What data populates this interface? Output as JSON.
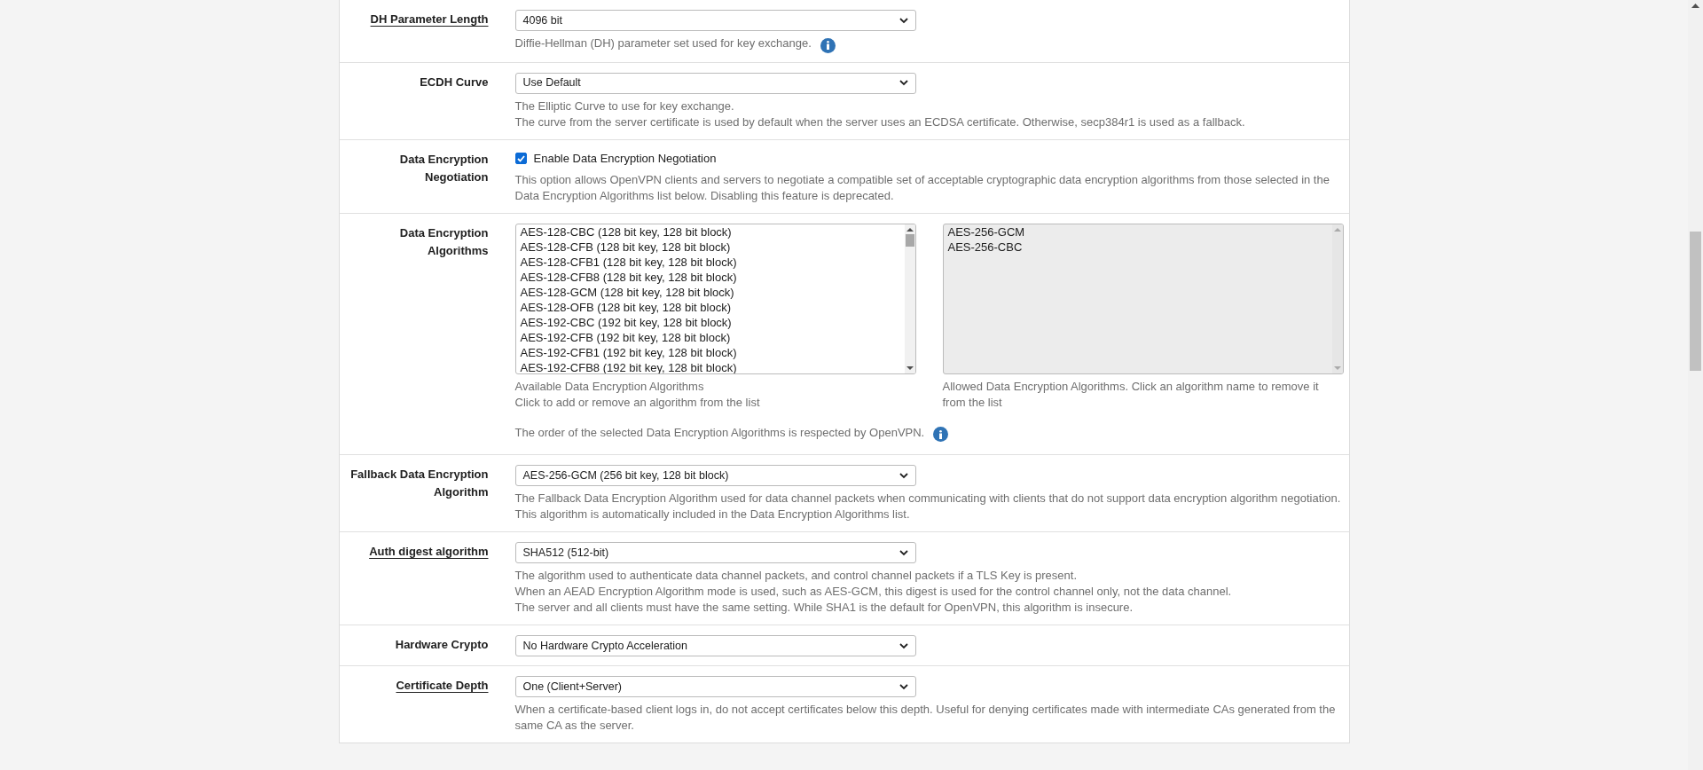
{
  "rows": [
    {
      "label": "DH Parameter Length",
      "label_link": true,
      "kind": "select",
      "value": "4096 bit",
      "help": [
        "Diffie-Hellman (DH) parameter set used for key exchange."
      ],
      "info": true
    },
    {
      "label": "ECDH Curve",
      "label_link": false,
      "kind": "select",
      "value": "Use Default",
      "help": [
        "The Elliptic Curve to use for key exchange.",
        "The curve from the server certificate is used by default when the server uses an ECDSA certificate. Otherwise, secp384r1 is used as a fallback."
      ],
      "info": false
    },
    {
      "label": "Data Encryption Negotiation",
      "label_link": false,
      "kind": "checkbox",
      "checked": true,
      "value": "Enable Data Encryption Negotiation",
      "help": [
        "This option allows OpenVPN clients and servers to negotiate a compatible set of acceptable cryptographic data encryption algorithms from those selected in the Data Encryption Algorithms list below. Disabling this feature is deprecated."
      ],
      "info": false
    },
    {
      "label": "Data Encryption Algorithms",
      "label_link": false,
      "kind": "dual-list",
      "available": [
        "AES-128-CBC (128 bit key, 128 bit block)",
        "AES-128-CFB (128 bit key, 128 bit block)",
        "AES-128-CFB1 (128 bit key, 128 bit block)",
        "AES-128-CFB8 (128 bit key, 128 bit block)",
        "AES-128-GCM (128 bit key, 128 bit block)",
        "AES-128-OFB (128 bit key, 128 bit block)",
        "AES-192-CBC (192 bit key, 128 bit block)",
        "AES-192-CFB (192 bit key, 128 bit block)",
        "AES-192-CFB1 (192 bit key, 128 bit block)",
        "AES-192-CFB8 (192 bit key, 128 bit block)"
      ],
      "available_help": [
        "Available Data Encryption Algorithms",
        "Click to add or remove an algorithm from the list"
      ],
      "allowed": [
        "AES-256-GCM",
        "AES-256-CBC"
      ],
      "allowed_help": [
        "Allowed Data Encryption Algorithms. Click an algorithm name to remove it from the list"
      ],
      "help": [
        "The order of the selected Data Encryption Algorithms is respected by OpenVPN."
      ],
      "info": true
    },
    {
      "label": "Fallback Data Encryption Algorithm",
      "label_link": false,
      "kind": "select",
      "value": "AES-256-GCM (256 bit key, 128 bit block)",
      "help": [
        "The Fallback Data Encryption Algorithm used for data channel packets when communicating with clients that do not support data encryption algorithm negotiation. This algorithm is automatically included in the Data Encryption Algorithms list."
      ],
      "info": false
    },
    {
      "label": "Auth digest algorithm",
      "label_link": true,
      "kind": "select",
      "value": "SHA512 (512-bit)",
      "help": [
        "The algorithm used to authenticate data channel packets, and control channel packets if a TLS Key is present.",
        "When an AEAD Encryption Algorithm mode is used, such as AES-GCM, this digest is used for the control channel only, not the data channel.",
        "The server and all clients must have the same setting. While SHA1 is the default for OpenVPN, this algorithm is insecure."
      ],
      "info": false
    },
    {
      "label": "Hardware Crypto",
      "label_link": false,
      "kind": "select",
      "value": "No Hardware Crypto Acceleration",
      "help": [],
      "info": false
    },
    {
      "label": "Certificate Depth",
      "label_link": true,
      "kind": "select",
      "value": "One (Client+Server)",
      "help": [
        "When a certificate-based client logs in, do not accept certificates below this depth. Useful for denying certificates made with intermediate CAs generated from the same CA as the server."
      ],
      "info": false
    }
  ]
}
